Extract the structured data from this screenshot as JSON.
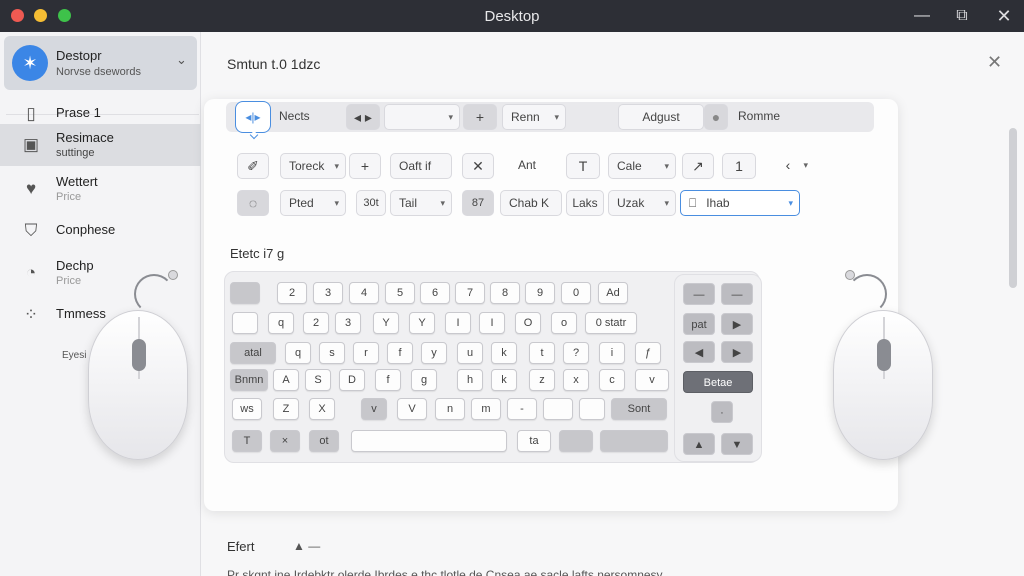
{
  "window": {
    "title": "Desktop",
    "controls": {
      "minimize": "—",
      "maximize": "⧉",
      "close": "✕"
    }
  },
  "sidebar": {
    "profile": {
      "name": "Destopr",
      "subtitle": "Norvse dsewords"
    },
    "items": [
      {
        "label": "Prase 1",
        "sub": "",
        "icon": "device-icon"
      },
      {
        "label": "Resimace",
        "sub": "suttinge",
        "icon": "window-icon"
      },
      {
        "label": "Wettert",
        "sub": "Price",
        "icon": "heart-icon"
      },
      {
        "label": "Conphese",
        "sub": "",
        "icon": "tshirt-icon"
      },
      {
        "label": "Dechp",
        "sub": "Price",
        "icon": "gauge-icon"
      },
      {
        "label": "Tmmess",
        "sub": "",
        "icon": "dots-icon"
      }
    ],
    "extra": "Eyesi"
  },
  "main": {
    "title": "Smtun t.0 1dzc",
    "section_label": "Etetc i7 g",
    "footer_label": "Efert",
    "footer_ctl": "▲ —",
    "footer_text": "Pr skgnt ine Irdebktr olerde Ibrdes e thc tlotle de Cnsea ae sacle lafts nersomnesy"
  },
  "toolbar": {
    "row1": {
      "bubble": "◂|▸",
      "nects": "Nects",
      "move": "◂ ▸",
      "blank": "",
      "plus": "+",
      "renn": "Renn",
      "adgust": "Adgust",
      "dot": "●",
      "romme": "Romme"
    },
    "row2": {
      "arrow": "✐",
      "toreck": "Toreck",
      "plus": "+",
      "oaft": "Oaft",
      "oaft_mark": "if",
      "x": "✕",
      "ant": "Ant",
      "t": "T",
      "cale": "Cale",
      "nearrow": "↗",
      "one": "1",
      "lt": "‹"
    },
    "row3": {
      "copy": "◌",
      "pted": "Pted",
      "dot": "30t",
      "tail": "Tail",
      "eight": "87",
      "chab": "Chab",
      "chab_mark": "K",
      "laks": "Laks",
      "uzak": "Uzak",
      "tab": "Ihab",
      "tab_icon": "⎕"
    }
  },
  "keyboard": {
    "rows": [
      [
        "",
        "2",
        "3",
        "4",
        "5",
        "6",
        "7",
        "8",
        "9",
        "0",
        "Ad"
      ],
      [
        "",
        "q",
        "2",
        "3",
        "Y",
        "Y",
        "I",
        "I",
        "O",
        "o",
        "0 statr"
      ],
      [
        "atal",
        "q",
        "s",
        "r",
        "f",
        "y",
        "u",
        "k",
        "t",
        "?",
        "i",
        "ƒ"
      ],
      [
        "Bnmn",
        "A",
        "S",
        "D",
        "f",
        "g",
        "h",
        "k",
        "z",
        "x",
        "c",
        "v"
      ],
      [
        "ws",
        "Z",
        "X",
        "v",
        "V",
        "n",
        "m",
        "-",
        "",
        "",
        "Sont"
      ],
      [
        "T",
        "×",
        "ot",
        "",
        "ta",
        "",
        "",
        ""
      ]
    ],
    "numpad": {
      "r1": [
        "—",
        "—"
      ],
      "r2": [
        "pat",
        "▶"
      ],
      "r3": [
        "◀",
        "▶"
      ],
      "r4": [
        "Betae"
      ],
      "r5": [
        "·"
      ],
      "r6": [
        "▲",
        "▼"
      ]
    }
  },
  "colors": {
    "accent": "#4a8ee0",
    "titlebar": "#2d2f36",
    "avatar": "#3b86e6"
  }
}
